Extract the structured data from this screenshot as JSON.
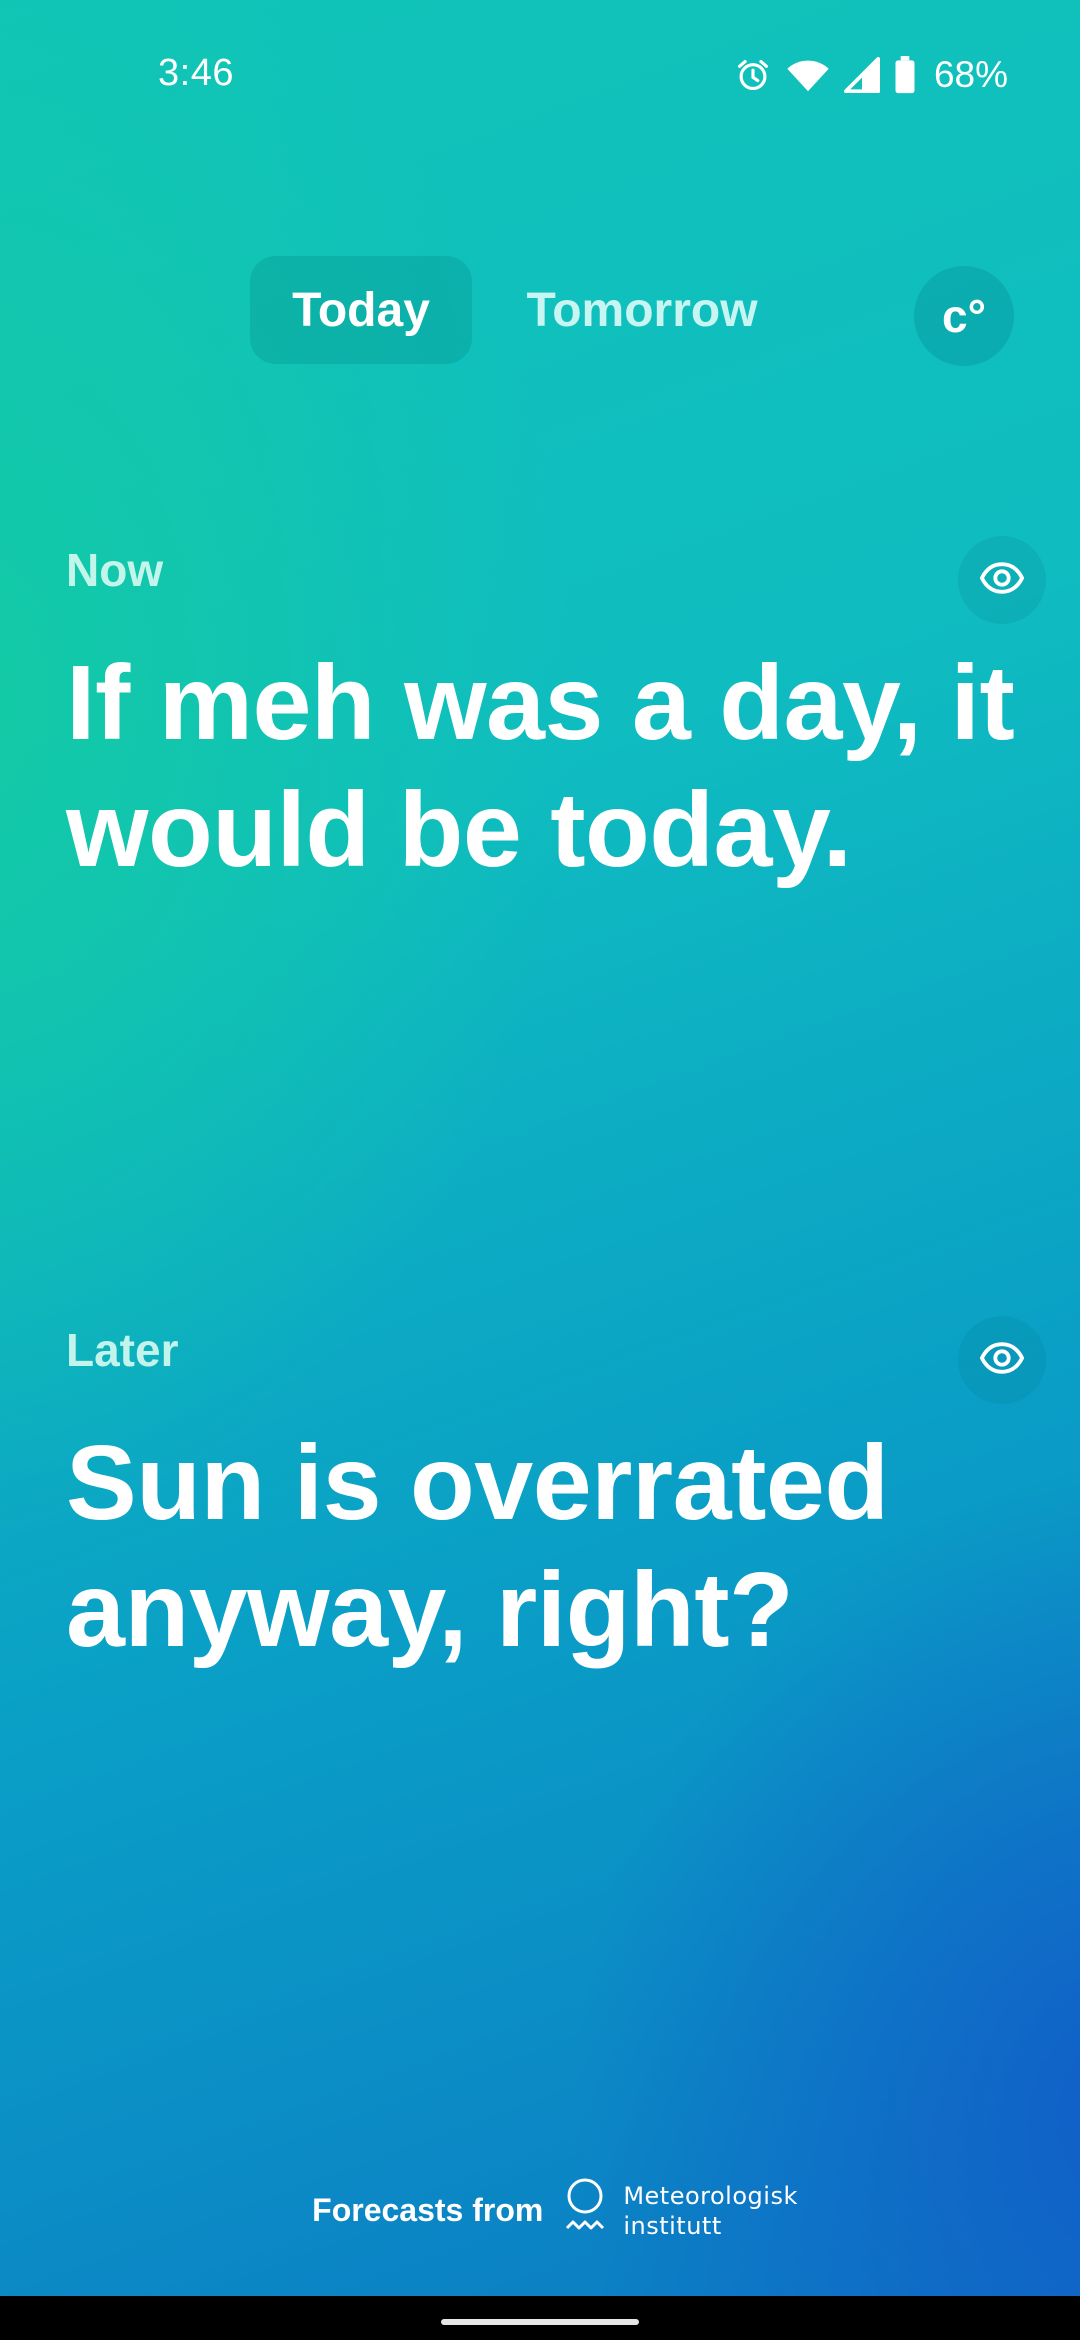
{
  "status_bar": {
    "time": "3:46",
    "battery_percent": "68%",
    "icons": [
      "alarm-icon",
      "wifi-icon",
      "signal-icon",
      "battery-icon"
    ]
  },
  "tabs": [
    {
      "label": "Today",
      "selected": true
    },
    {
      "label": "Tomorrow",
      "selected": false
    }
  ],
  "unit_toggle": {
    "label": "c°"
  },
  "now": {
    "label": "Now",
    "text": "If meh was a day, it would be today."
  },
  "later": {
    "label": "Later",
    "text": "Sun is overrated anyway, right?"
  },
  "footer": {
    "label": "Forecasts from",
    "provider_line1": "Meteorologisk",
    "provider_line2": "institutt"
  },
  "colors": {
    "gradient_top_left": "#10c4b8",
    "gradient_bottom_right": "#0c78c4",
    "text": "#ffffff",
    "label_text": "#d2faf0"
  }
}
